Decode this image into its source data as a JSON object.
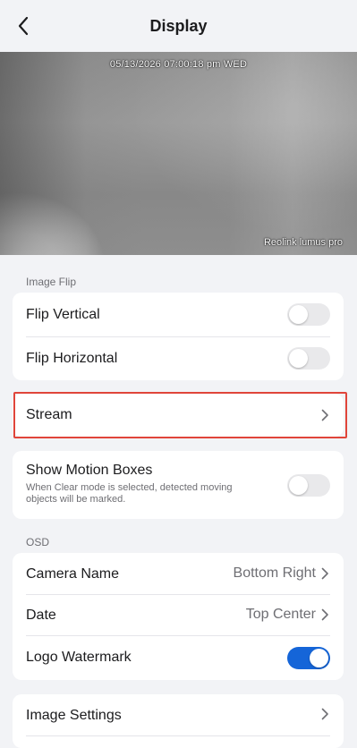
{
  "header": {
    "title": "Display"
  },
  "preview": {
    "timestamp": "05/13/2026 07:00:18 pm WED",
    "camera_name": "Reolink lumus pro"
  },
  "image_flip": {
    "label": "Image Flip",
    "flip_vertical": {
      "label": "Flip Vertical",
      "on": false
    },
    "flip_horizontal": {
      "label": "Flip Horizontal",
      "on": false
    }
  },
  "stream": {
    "label": "Stream"
  },
  "motion": {
    "label": "Show Motion Boxes",
    "description_line1": "When Clear mode is selected, detected moving",
    "description_line2": "objects will be marked.",
    "on": false
  },
  "osd": {
    "label": "OSD",
    "camera_name": {
      "label": "Camera Name",
      "value": "Bottom Right"
    },
    "date": {
      "label": "Date",
      "value": "Top Center"
    },
    "logo": {
      "label": "Logo Watermark",
      "on": true
    }
  },
  "image_settings": {
    "label": "Image Settings"
  },
  "colors": {
    "accent": "#1565d8",
    "highlight": "#e0453a"
  }
}
